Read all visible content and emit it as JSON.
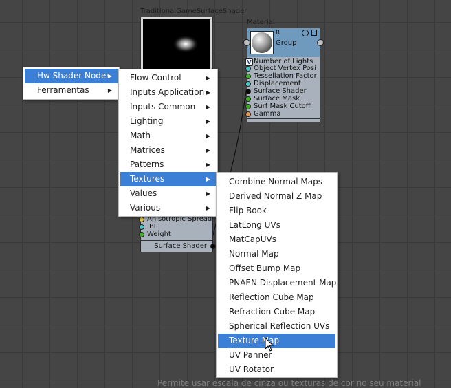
{
  "nodes": {
    "surface_shader": {
      "title": "TraditionalGameSurfaceShader",
      "attrs": [
        "Anisotropic Spread",
        "IBL",
        "Weight"
      ],
      "footer": "Surface Shader"
    },
    "material": {
      "title": "Material",
      "swatch_label": "R",
      "group_label": "Group",
      "attrs": [
        "Number of Lights",
        "Object Vertex Posi",
        "Tessellation Factor",
        "Displacement",
        "Surface Shader",
        "Surface Mask",
        "Surf Mask Cutoff",
        "Gamma"
      ]
    }
  },
  "context_menu": {
    "level1": [
      {
        "label": "Hw Shader Nodes",
        "submenu": true,
        "selected": true
      },
      {
        "label": "Ferramentas",
        "submenu": true,
        "selected": false
      }
    ],
    "level2": [
      {
        "label": "Flow Control",
        "submenu": true
      },
      {
        "label": "Inputs Application",
        "submenu": true
      },
      {
        "label": "Inputs Common",
        "submenu": true
      },
      {
        "label": "Lighting",
        "submenu": true
      },
      {
        "label": "Math",
        "submenu": true
      },
      {
        "label": "Matrices",
        "submenu": true
      },
      {
        "label": "Patterns",
        "submenu": true
      },
      {
        "label": "Textures",
        "submenu": true,
        "selected": true
      },
      {
        "label": "Values",
        "submenu": true
      },
      {
        "label": "Various",
        "submenu": true
      }
    ],
    "level3": [
      {
        "label": "Combine Normal Maps"
      },
      {
        "label": "Derived Normal Z Map"
      },
      {
        "label": "Flip Book"
      },
      {
        "label": "LatLong UVs"
      },
      {
        "label": "MatCapUVs"
      },
      {
        "label": "Normal Map"
      },
      {
        "label": "Offset Bump Map"
      },
      {
        "label": "PNAEN Displacement Map"
      },
      {
        "label": "Reflection Cube Map"
      },
      {
        "label": "Refraction Cube Map"
      },
      {
        "label": "Spherical Reflection UVs"
      },
      {
        "label": "Texture Map",
        "selected": true
      },
      {
        "label": "UV Panner"
      },
      {
        "label": "UV Rotator"
      }
    ]
  },
  "status_bar": {
    "text": "Permite usar escala de cinza ou texturas de cor no seu material"
  },
  "colors": {
    "menu_selected": "#3c7fd7",
    "node_body": "#a9b2bc",
    "material_header": "#6f99bd",
    "port_yellow": "#e2c53a",
    "port_cyan": "#4fc6c6",
    "port_green": "#3fae28",
    "port_black": "#050505",
    "port_orange": "#e59a55"
  },
  "icons": {
    "submenu_arrow": "triangle-right-icon",
    "cursor": "mouse-pointer-icon",
    "v_badge": "v-badge-icon"
  }
}
